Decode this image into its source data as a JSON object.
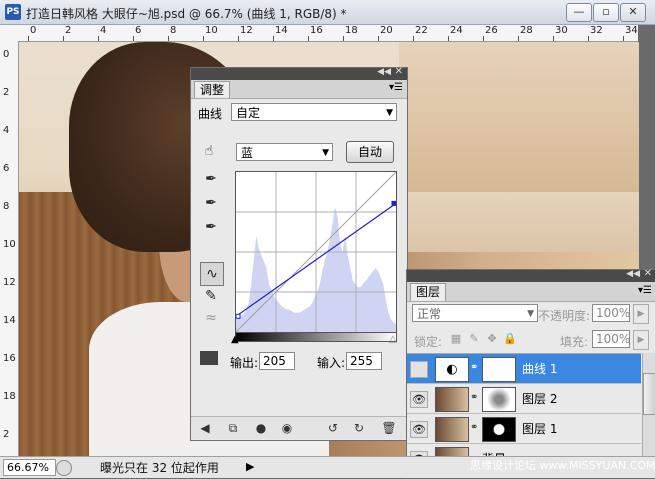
{
  "window": {
    "app_icon": "PS",
    "title": "打造日韩风格 大眼仔~旭.psd @ 66.7% (曲线 1, RGB/8) *",
    "buttons": {
      "minimize": "—",
      "restore": "▫",
      "close": "✕"
    }
  },
  "rulers": {
    "top": [
      "0",
      "2",
      "4",
      "6",
      "8",
      "10",
      "12",
      "14",
      "16",
      "18",
      "20",
      "22",
      "24",
      "26",
      "28",
      "30",
      "32",
      "34"
    ],
    "left": [
      "0",
      "2",
      "4",
      "6",
      "8",
      "10",
      "12",
      "14",
      "16",
      "18",
      "2"
    ]
  },
  "status_bar": {
    "zoom": "66.67%",
    "message": "曝光只在 32 位起作用",
    "arrow": "▶"
  },
  "adjustments": {
    "tab": "调整",
    "curve_label": "曲线",
    "preset": "自定",
    "channel": "蓝",
    "auto_button": "自动",
    "output_label": "输出:",
    "output_value": "205",
    "input_label": "输入:",
    "input_value": "255",
    "curve": {
      "start": [
        0,
        25
      ],
      "end": [
        255,
        205
      ],
      "histogram": [
        8,
        9,
        10,
        11,
        14,
        18,
        30,
        45,
        60,
        52,
        48,
        44,
        40,
        30,
        26,
        22,
        20,
        18,
        16,
        15,
        14,
        14,
        13,
        12,
        12,
        12,
        13,
        14,
        15,
        16,
        18,
        22,
        25,
        30,
        38,
        45,
        50,
        58,
        68,
        78,
        72,
        55,
        50,
        60,
        48,
        40,
        32,
        30,
        28,
        28,
        30,
        32,
        34,
        36,
        38,
        40,
        38,
        34,
        30,
        20,
        12,
        8,
        6,
        5
      ]
    }
  },
  "layers": {
    "tab": "图层",
    "blend_mode": "正常",
    "opacity_label": "不透明度:",
    "opacity_value": "100%",
    "lock_label": "锁定:",
    "fill_label": "填充:",
    "fill_value": "100%",
    "items": [
      {
        "name": "曲线 1",
        "selected": true
      },
      {
        "name": "图层 2",
        "selected": false
      },
      {
        "name": "图层 1",
        "selected": false
      },
      {
        "name": "背景",
        "selected": false
      }
    ]
  },
  "watermark": "思缘设计论坛 www.MISSYUAN.COM"
}
